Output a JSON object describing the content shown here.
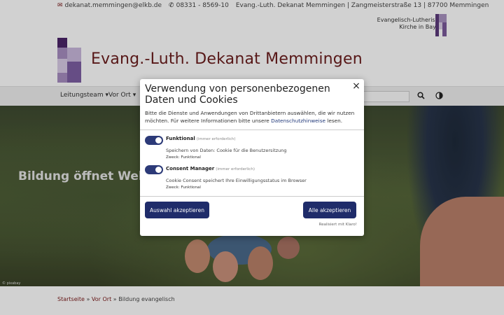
{
  "topbar": {
    "email": "dekanat.memmingen@elkb.de",
    "phone": "08331 - 8569-10",
    "address": "Evang.-Luth. Dekanat Memmingen | Zangmeisterstraße 13 | 87700 Memmingen"
  },
  "elkb": {
    "line1": "Evangelisch-Lutherische",
    "line2": "Kirche in Bayern"
  },
  "site_title": "Evang.-Luth. Dekanat Memmingen",
  "nav": {
    "items": [
      {
        "label": "Leitungsteam ▾"
      },
      {
        "label": "Vor Ort ▾"
      }
    ]
  },
  "hero": {
    "text": "Bildung öffnet Welte",
    "credit": "© pixabay"
  },
  "breadcrumb": {
    "home": "Startseite",
    "sep1": " » ",
    "section": "Vor Ort",
    "sep2": " » ",
    "current": "Bildung evangelisch"
  },
  "cookie_modal": {
    "title": "Verwendung von personenbezogenen Daten und Cookies",
    "intro_text": "Bitte die Dienste und Anwendungen von Drittanbietern auswählen, die wir nutzen möchten. Für weitere Informationen bitte unsere ",
    "intro_link": "Datenschutzhinweise",
    "intro_end": " lesen.",
    "close": "×",
    "options": [
      {
        "name": "Funktional",
        "note": "(immer erforderlich)",
        "desc": "Speichern von Daten: Cookie für die Benutzersitzung",
        "purpose": "Zweck: Funktional"
      },
      {
        "name": "Consent Manager",
        "note": "(immer erforderlich)",
        "desc": "Cookie Consent speichert Ihre Einwilligungsstatus im Browser",
        "purpose": "Zweck: Funktional"
      }
    ],
    "btn_selection": "Auswahl akzeptieren",
    "btn_all": "Alle akzeptieren",
    "powered": "Realisiert mit Klaro!"
  },
  "colors": {
    "brand": "#6b1d1d",
    "accent": "#1f2c6a"
  }
}
